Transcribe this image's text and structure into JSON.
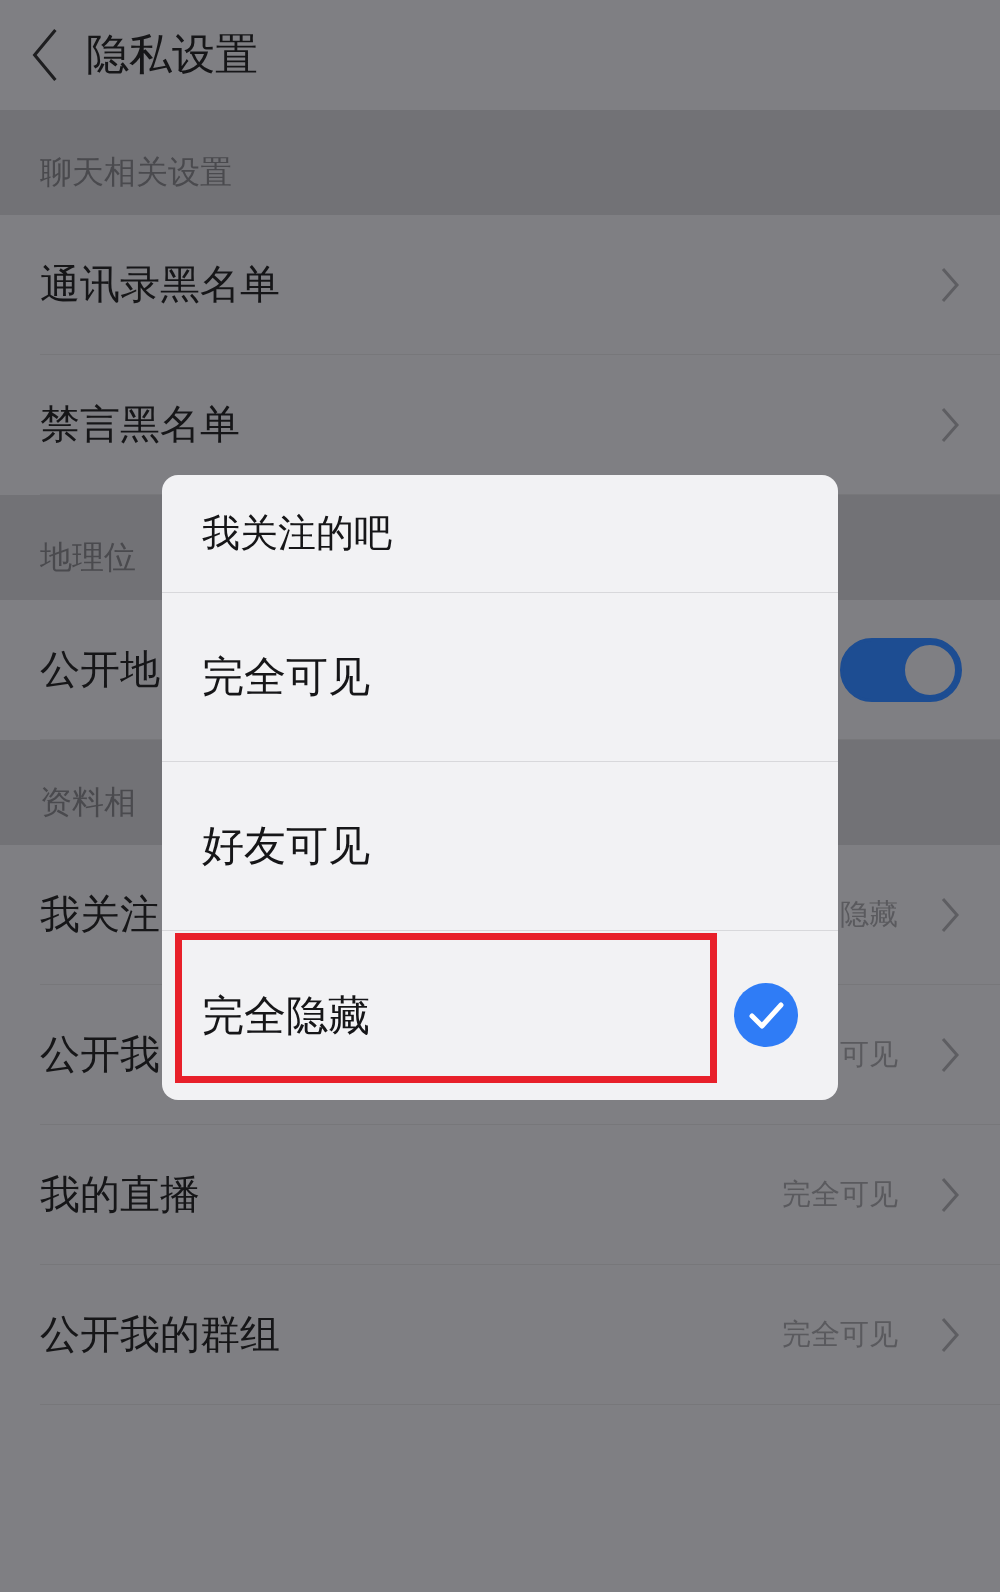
{
  "nav": {
    "title": "隐私设置"
  },
  "sections": [
    {
      "header": "聊天相关设置",
      "rows": [
        {
          "kind": "link",
          "label": "通讯录黑名单"
        },
        {
          "kind": "link",
          "label": "禁言黑名单"
        }
      ]
    },
    {
      "header": "地理位",
      "rows": [
        {
          "kind": "toggle",
          "label": "公开地",
          "on": true
        }
      ]
    },
    {
      "header": "资料相",
      "rows": [
        {
          "kind": "link",
          "label": "我关注",
          "value": "隐藏"
        },
        {
          "kind": "link",
          "label": "公开我",
          "value": "可见"
        },
        {
          "kind": "link",
          "label": "我的直播",
          "value": "完全可见"
        },
        {
          "kind": "link",
          "label": "公开我的群组",
          "value": "完全可见"
        }
      ]
    }
  ],
  "dialog": {
    "title": "我关注的吧",
    "options": [
      {
        "label": "完全可见",
        "selected": false,
        "highlighted": false
      },
      {
        "label": "好友可见",
        "selected": false,
        "highlighted": false
      },
      {
        "label": "完全隐藏",
        "selected": true,
        "highlighted": true
      }
    ]
  }
}
